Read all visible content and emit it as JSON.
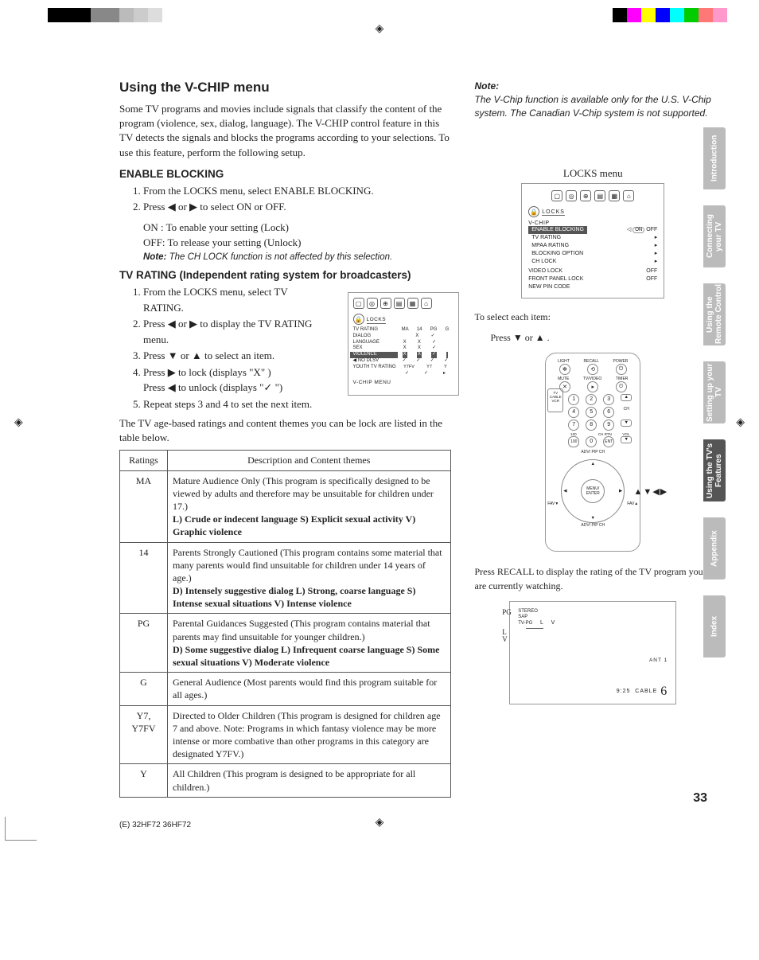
{
  "title": "Using the V-CHIP menu",
  "intro": "Some TV programs and movies include signals that classify the content of the program (violence, sex, dialog, language). The V-CHIP control feature in this TV detects the signals and blocks the programs according to your selections. To use this feature, perform the following setup.",
  "enable_blocking": {
    "heading": "ENABLE BLOCKING",
    "step1": "From the LOCKS menu, select ENABLE BLOCKING.",
    "step2": "Press ◀ or ▶ to select ON or OFF.",
    "on_line": "ON : To enable your setting (Lock)",
    "off_line": "OFF: To release your setting (Unlock)",
    "note": "The CH LOCK function is not affected by this selection."
  },
  "tv_rating": {
    "heading": "TV RATING (Independent rating system for broadcasters)",
    "step1": "From the LOCKS menu, select TV RATING.",
    "step2": "Press ◀ or ▶ to display the TV RATING menu.",
    "step3": "Press ▼ or ▲ to select an item.",
    "step4_a": "Press ▶ to lock (displays \"X\" )",
    "step4_b": "Press ◀ to unlock (displays \"✓ \")",
    "step5": "Repeat steps 3 and 4 to set the next item.",
    "after": "The TV age-based ratings and content themes you can be lock are listed in the table below."
  },
  "osd_small": {
    "locks": "LOCKS",
    "tv_rating": "TV RATING",
    "dialog": "DIALOG",
    "language": "LANGUAGE",
    "sex": "SEX",
    "violence": "VIOLENCE",
    "no_dlsv": "NO DLSV",
    "youth": "YOUTH TV RATING",
    "footer": "V-CHIP MENU",
    "cols": [
      "MA",
      "14",
      "PG",
      "G"
    ],
    "sub_cols": [
      "Y7FV",
      "Y7",
      "Y"
    ]
  },
  "ratings_table": {
    "header_rating": "Ratings",
    "header_desc": "Description and Content themes",
    "rows": [
      {
        "r": "MA",
        "d": "Mature Audience Only (This program is specifically designed to be viewed by adults and therefore may be unsuitable for children under 17.)",
        "b": "L) Crude or indecent language  S) Explicit sexual activity  V) Graphic violence"
      },
      {
        "r": "14",
        "d": "Parents Strongly Cautioned (This program contains some material that many parents would find unsuitable for children under 14 years of age.)",
        "b": "D) Intensely suggestive dialog  L) Strong, coarse language  S) Intense sexual situations  V) Intense violence"
      },
      {
        "r": "PG",
        "d": "Parental Guidances Suggested (This program contains material that parents may find unsuitable for younger children.)",
        "b": "D) Some suggestive dialog  L) Infrequent coarse language  S) Some sexual situations  V) Moderate violence"
      },
      {
        "r": "G",
        "d": "General Audience (Most parents would find this program suitable for all ages.)",
        "b": ""
      },
      {
        "r": "Y7, Y7FV",
        "d": "Directed to Older Children (This program is designed for children age 7 and above. Note: Programs in which fantasy violence may be more intense or more combative than other programs in this category are designated Y7FV.)",
        "b": ""
      },
      {
        "r": "Y",
        "d": "All Children (This program is designed to be appropriate for all children.)",
        "b": ""
      }
    ]
  },
  "right": {
    "note_label": "Note:",
    "note_text": "The V-Chip function is available only for the U.S. V-Chip system. The Canadian V-Chip system is not supported.",
    "locks_menu_title": "LOCKS menu",
    "locks_osd": {
      "locks": "LOCKS",
      "vchip": "V-CHIP",
      "enable_blocking": "ENABLE BLOCKING",
      "on": "ON",
      "off": "OFF",
      "tv_rating": "TV RATING",
      "mpaa": "MPAA RATING",
      "blocking_opt": "BLOCKING OPTION",
      "ch_lock": "CH LOCK",
      "video_lock": "VIDEO LOCK",
      "front_panel": "FRONT PANEL LOCK",
      "new_pin": "NEW PIN CODE",
      "off_val": "OFF"
    },
    "select_each": "To select each item:",
    "press_ud": "Press ▼ or ▲ .",
    "remote_labels": {
      "light": "LIGHT",
      "recall": "RECALL",
      "power": "POWER",
      "mute": "MUTE",
      "tvvideo": "TV/VIDEO",
      "timer": "TIMER",
      "tv": "TV",
      "cable": "CABLE",
      "vcr": "VCR",
      "ch": "CH",
      "vol": "VOL",
      "ent": "ENT",
      "menu": "MENU/\nENTER",
      "adv_pip": "ADV/\nPIP CH",
      "fav": "FAV",
      "chrtn": "CH RTN",
      "100": "100"
    },
    "arrows_hint": "▲▼◀▶",
    "recall_text": "Press RECALL to display the rating of the TV program you are currently watching.",
    "tv_osd": {
      "stereo": "STEREO",
      "sap": "SAP",
      "tvpg": "TV-PG",
      "L": "L",
      "V": "V",
      "ant": "ANT  1",
      "time": "9:25",
      "cable": "CABLE",
      "ch": "6",
      "left_pg": "PG",
      "left_l": "L",
      "left_v": "V"
    }
  },
  "side_tabs": [
    "Introduction",
    "Connecting your TV",
    "Using the Remote Control",
    "Setting up your TV",
    "Using the TV's Features",
    "Appendix",
    "Index"
  ],
  "page_number": "33",
  "footer_code": "(E) 32HF72 36HF72",
  "color_bars": {
    "left": [
      "#000",
      "#000",
      "#000",
      "#888",
      "#888",
      "#bbb",
      "#ccc",
      "#ddd"
    ],
    "right": [
      "#000",
      "#f0f",
      "#ff0",
      "#00f",
      "#0ff",
      "#0c0",
      "#f77",
      "#f9c"
    ]
  }
}
